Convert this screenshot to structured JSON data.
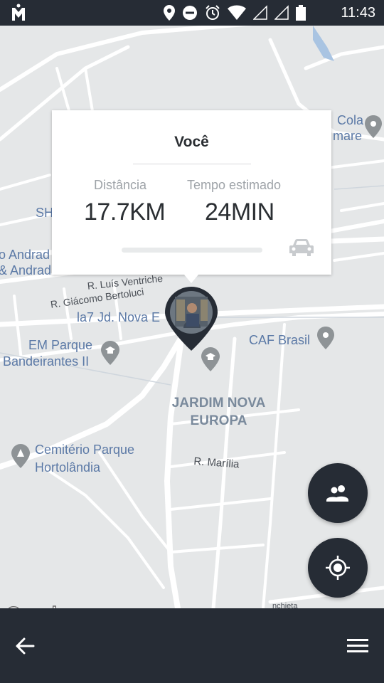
{
  "status_bar": {
    "time": "11:43",
    "icons": [
      "app-logo-icon",
      "location-icon",
      "do-not-disturb-icon",
      "alarm-icon",
      "wifi-icon",
      "signal-icon",
      "signal-icon-2",
      "battery-icon"
    ]
  },
  "map": {
    "labels": {
      "cola": "Cola",
      "amare": "mare",
      "sh": "SH",
      "andrad1": "o Andrad",
      "andrad2": "& Andrad",
      "r_luis": "R. Luís Ventriche",
      "r_giacomo": "R. Giácomo Bertoluci",
      "la7": "la7 Jd. Nova E",
      "em_parque1": "EM Parque",
      "em_parque2": "Bandeirantes II",
      "caf": "CAF Brasil",
      "jardim1": "JARDIM NOVA",
      "jardim2": "EUROPA",
      "cemiterio1": "Cemitério Parque",
      "cemiterio2": "Hortolândia",
      "r_marilia": "R. Marília",
      "anchieta": "nchieta"
    },
    "attribution": "Google"
  },
  "info_card": {
    "title": "Você",
    "distance_label": "Distância",
    "distance_value": "17.7KM",
    "time_label": "Tempo estimado",
    "time_value": "24MIN",
    "progress_percent": 0,
    "icon": "car-icon"
  },
  "buttons": {
    "people_icon": "people-icon",
    "my_location_icon": "my-location-icon"
  },
  "bottom_bar": {
    "back_icon": "back-arrow-icon",
    "menu_icon": "menu-icon"
  },
  "colors": {
    "dark": "#262c35",
    "map_bg": "#e5e7e8",
    "road": "#ffffff",
    "label_blue": "#5b6d84"
  }
}
